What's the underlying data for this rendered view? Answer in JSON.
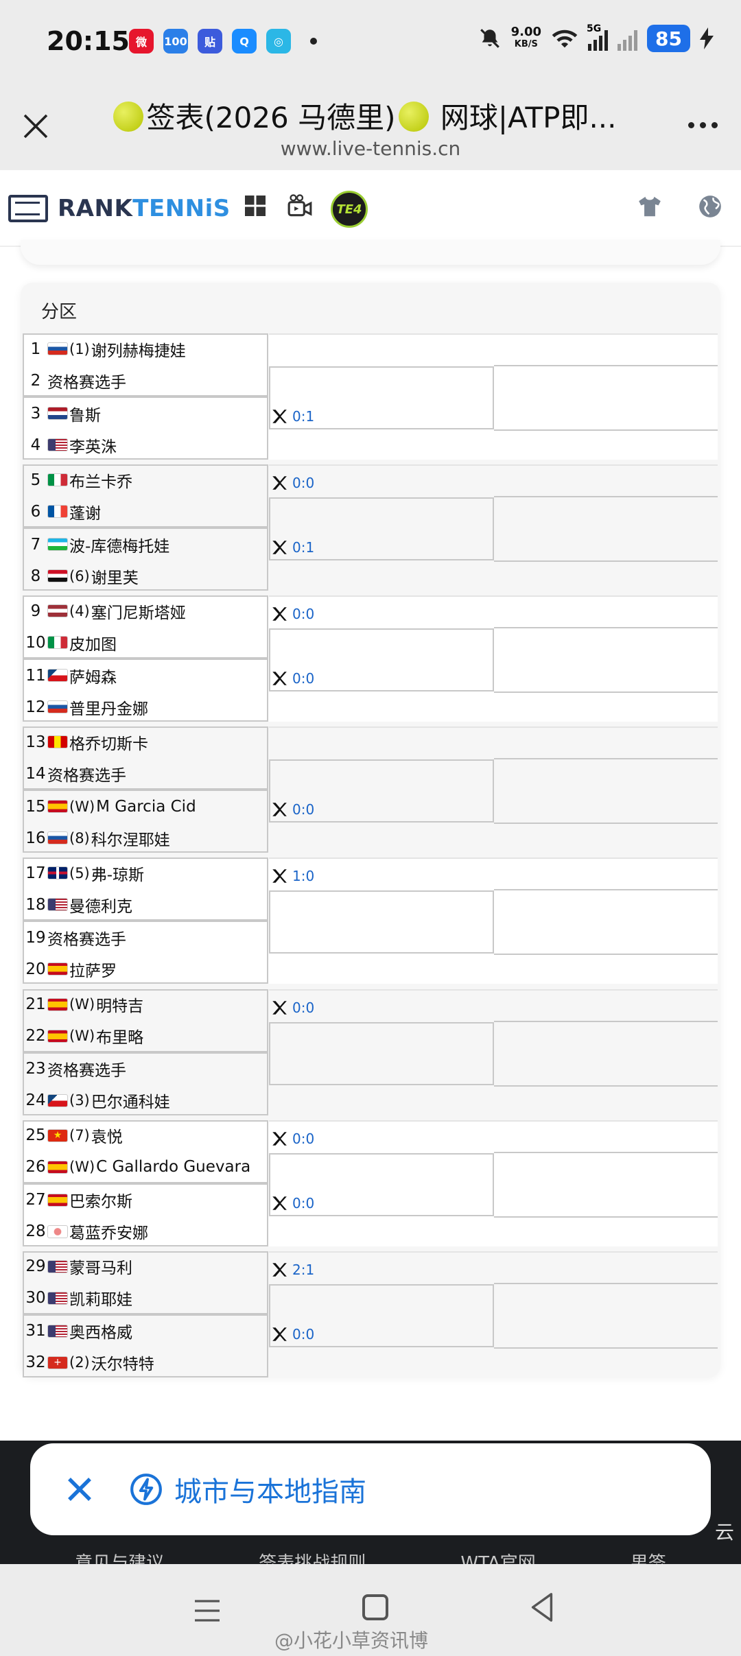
{
  "status_bar": {
    "time": "20:15",
    "net_speed_value": "9.00",
    "net_speed_unit": "KB/S",
    "network": "5G",
    "battery": "85",
    "app_icons": [
      {
        "name": "weibo",
        "color": "#e6162d",
        "glyph": "微"
      },
      {
        "name": "app-100",
        "color": "#2b7fe8",
        "glyph": "100"
      },
      {
        "name": "tieba",
        "color": "#3c5bdc",
        "glyph": "贴"
      },
      {
        "name": "qq",
        "color": "#1a8cff",
        "glyph": "Q"
      },
      {
        "name": "video-app",
        "color": "#2bb7e6",
        "glyph": "◎"
      }
    ]
  },
  "browser": {
    "title_pre": "签表(2026 马德里)",
    "title_post": " 网球|ATP即...",
    "url": "www.live-tennis.cn"
  },
  "site": {
    "logo_prefix": "RANK",
    "logo_suffix": "TENNiS",
    "te4_label": "TE4"
  },
  "section": {
    "title": "分区"
  },
  "players": [
    {
      "num": "1",
      "flag": "ru",
      "seed": "(1)",
      "name": "谢列赫梅捷娃"
    },
    {
      "num": "2",
      "flag": "",
      "seed": "",
      "name": "资格赛选手"
    },
    {
      "num": "3",
      "flag": "nl",
      "seed": "",
      "name": "鲁斯"
    },
    {
      "num": "4",
      "flag": "us",
      "seed": "",
      "name": "李英洙"
    },
    {
      "num": "5",
      "flag": "it",
      "seed": "",
      "name": "布兰卡乔"
    },
    {
      "num": "6",
      "flag": "fr",
      "seed": "",
      "name": "蓬谢"
    },
    {
      "num": "7",
      "flag": "uz",
      "seed": "",
      "name": "波-库德梅托娃"
    },
    {
      "num": "8",
      "flag": "eg",
      "seed": "(6)",
      "name": "谢里芙"
    },
    {
      "num": "9",
      "flag": "lv",
      "seed": "(4)",
      "name": "塞门尼斯塔娅"
    },
    {
      "num": "10",
      "flag": "it",
      "seed": "",
      "name": "皮加图"
    },
    {
      "num": "11",
      "flag": "cz",
      "seed": "",
      "name": "萨姆森"
    },
    {
      "num": "12",
      "flag": "ru",
      "seed": "",
      "name": "普里丹金娜"
    },
    {
      "num": "13",
      "flag": "mk",
      "seed": "",
      "name": "格乔切斯卡"
    },
    {
      "num": "14",
      "flag": "",
      "seed": "",
      "name": "资格赛选手"
    },
    {
      "num": "15",
      "flag": "es",
      "seed": "(W)",
      "name": "M Garcia Cid"
    },
    {
      "num": "16",
      "flag": "ru",
      "seed": "(8)",
      "name": "科尔涅耶娃"
    },
    {
      "num": "17",
      "flag": "gb",
      "seed": "(5)",
      "name": "弗-琼斯"
    },
    {
      "num": "18",
      "flag": "us",
      "seed": "",
      "name": "曼德利克"
    },
    {
      "num": "19",
      "flag": "",
      "seed": "",
      "name": "资格赛选手"
    },
    {
      "num": "20",
      "flag": "es",
      "seed": "",
      "name": "拉萨罗"
    },
    {
      "num": "21",
      "flag": "es",
      "seed": "(W)",
      "name": "明特吉"
    },
    {
      "num": "22",
      "flag": "es",
      "seed": "(W)",
      "name": "布里略"
    },
    {
      "num": "23",
      "flag": "",
      "seed": "",
      "name": "资格赛选手"
    },
    {
      "num": "24",
      "flag": "cz",
      "seed": "(3)",
      "name": "巴尔通科娃"
    },
    {
      "num": "25",
      "flag": "cn",
      "seed": "(7)",
      "name": "袁悦"
    },
    {
      "num": "26",
      "flag": "es",
      "seed": "(W)",
      "name": "C Gallardo Guevara"
    },
    {
      "num": "27",
      "flag": "es",
      "seed": "",
      "name": "巴索尔斯"
    },
    {
      "num": "28",
      "flag": "tpe",
      "seed": "",
      "name": "葛蓝乔安娜"
    },
    {
      "num": "29",
      "flag": "us",
      "seed": "",
      "name": "蒙哥马利"
    },
    {
      "num": "30",
      "flag": "us",
      "seed": "",
      "name": "凯莉耶娃"
    },
    {
      "num": "31",
      "flag": "us",
      "seed": "",
      "name": "奥西格威"
    },
    {
      "num": "32",
      "flag": "ch",
      "seed": "(2)",
      "name": "沃尔特特"
    }
  ],
  "matches": [
    {
      "match": 1,
      "score": ""
    },
    {
      "match": 2,
      "score": "0:1"
    },
    {
      "match": 3,
      "score": "0:0"
    },
    {
      "match": 4,
      "score": "0:1"
    },
    {
      "match": 5,
      "score": "0:0"
    },
    {
      "match": 6,
      "score": "0:0"
    },
    {
      "match": 7,
      "score": ""
    },
    {
      "match": 8,
      "score": "0:0"
    },
    {
      "match": 9,
      "score": "1:0"
    },
    {
      "match": 10,
      "score": ""
    },
    {
      "match": 11,
      "score": "0:0"
    },
    {
      "match": 12,
      "score": ""
    },
    {
      "match": 13,
      "score": "0:0"
    },
    {
      "match": 14,
      "score": "0:0"
    },
    {
      "match": 15,
      "score": "2:1"
    },
    {
      "match": 16,
      "score": "0:0"
    }
  ],
  "popup": {
    "text": "城市与本地指南"
  },
  "footer_links": [
    "意见与建议",
    "签表挑战规则",
    "WTA官网",
    "男签"
  ],
  "footer_suffix": "云",
  "watermark": "@小花小草资讯博",
  "flag_colors": {
    "ru": [
      "#ffffff",
      "#1c57a5",
      "#d52b1e"
    ],
    "nl": [
      "#ae1c28",
      "#ffffff",
      "#21468b"
    ],
    "fr": [
      "#0055a4",
      "#ffffff",
      "#ef4135"
    ],
    "it": [
      "#009246",
      "#ffffff",
      "#ce2b37"
    ],
    "uz": [
      "#1eb5e6",
      "#ffffff",
      "#1eb53a"
    ],
    "eg": [
      "#ce1126",
      "#ffffff",
      "#111111"
    ],
    "lv": [
      "#9e3039",
      "#ffffff",
      "#9e3039"
    ],
    "cz": [
      "#ffffff",
      "#d7141a",
      "#11457e"
    ],
    "mk": [
      "#d20000",
      "#ffe600",
      "#d20000"
    ],
    "es": [
      "#c60b1e",
      "#ffc400",
      "#c60b1e"
    ],
    "gb": [
      "#012169",
      "#c8102e",
      "#012169"
    ],
    "us": [
      "#b22234",
      "#ffffff",
      "#3c3b6e"
    ],
    "cn": [
      "#de2910",
      "#de2910",
      "#de2910"
    ],
    "tpe": [
      "#ffffff",
      "#f0d0d8",
      "#ffffff"
    ],
    "ch": [
      "#d52b1e",
      "#d52b1e",
      "#d52b1e"
    ]
  }
}
